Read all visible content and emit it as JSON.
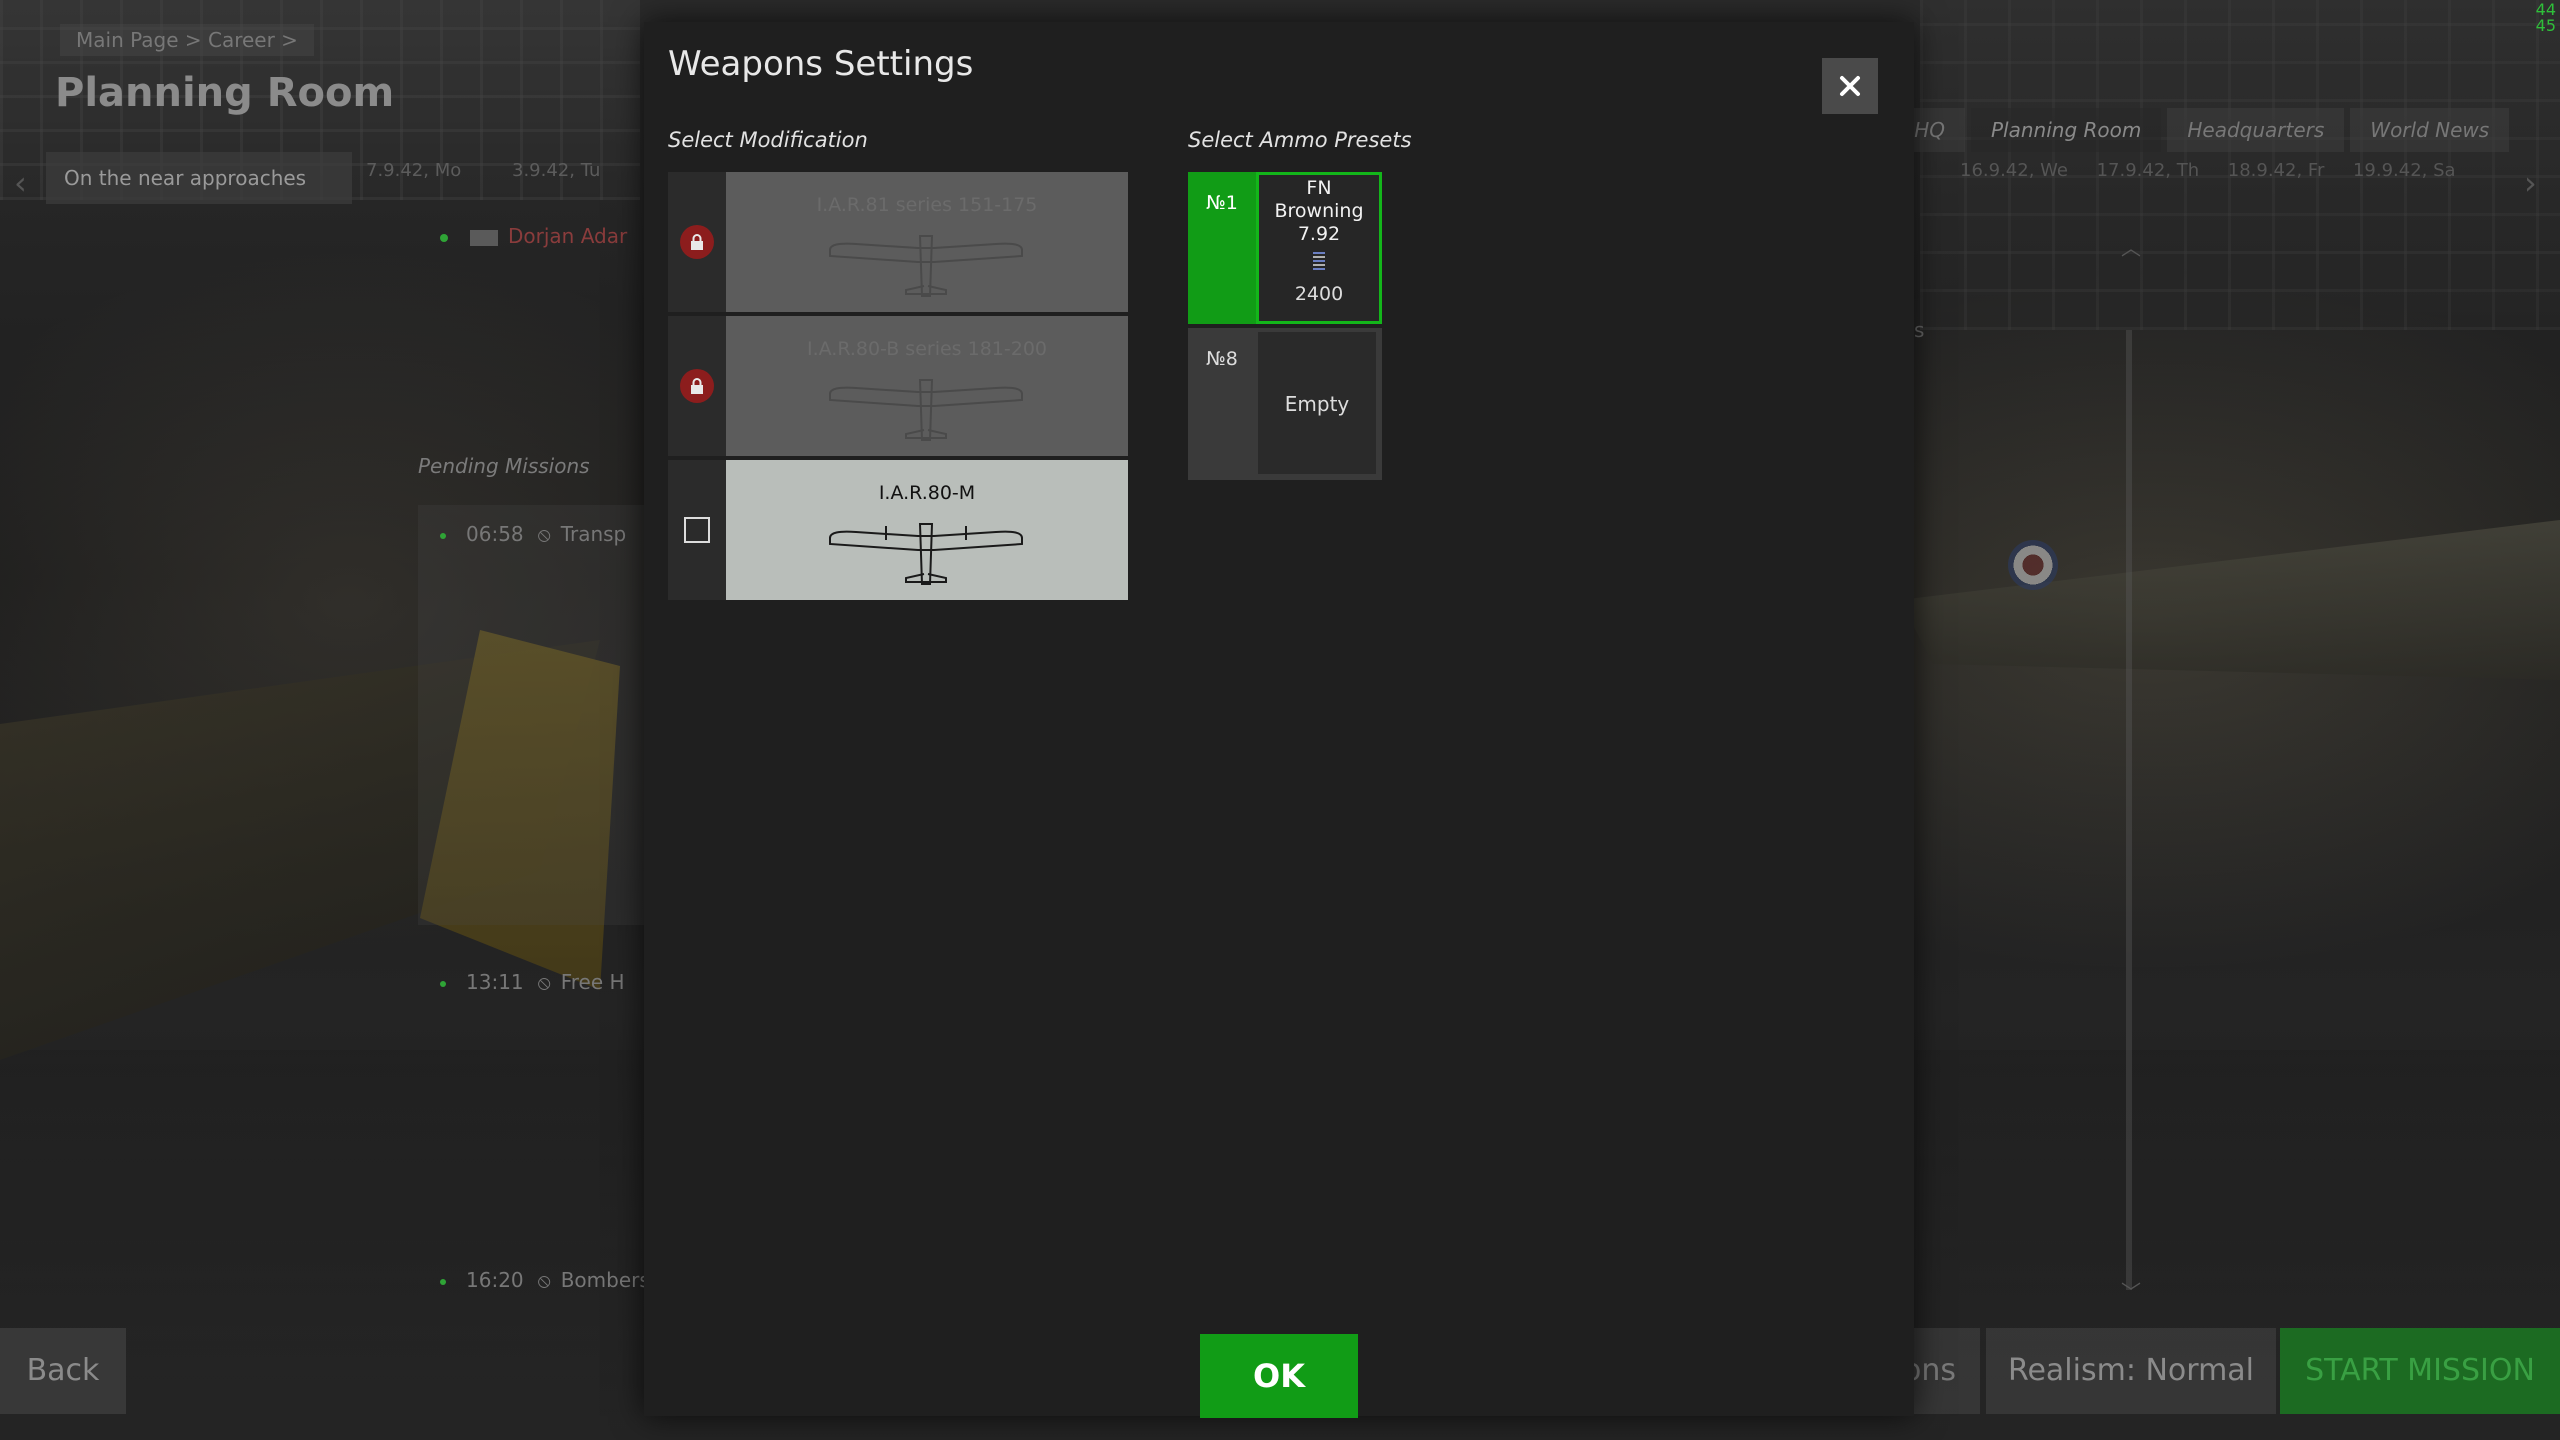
{
  "background": {
    "breadcrumb": "Main Page > Career >",
    "page_title": "Planning Room",
    "mission_name": "On the near approaches",
    "dates": [
      "7.9.42, Mo",
      "3.9.42, Tu"
    ],
    "pilot": "Dorjan Adar",
    "pending_label": "Pending Missions",
    "pending_missions": [
      {
        "time": "06:58",
        "label": "Transp"
      },
      {
        "time": "13:11",
        "label": "Free H"
      },
      {
        "time": "16:20",
        "label": "Bombers"
      }
    ],
    "tabs": [
      {
        "label": "t HQ"
      },
      {
        "label": "Planning Room"
      },
      {
        "label": "Headquarters"
      },
      {
        "label": "World News"
      }
    ],
    "right_dates": [
      "16.9.42, We",
      "17.9.42, Th",
      "18.9.42, Fr",
      "19.9.42, Sa"
    ],
    "partial_text": "s",
    "fps": [
      "44",
      "45"
    ],
    "back_label": "Back",
    "options_label": "ons",
    "realism_label": "Realism: Normal",
    "start_label": "START MISSION"
  },
  "dialog": {
    "title": "Weapons Settings",
    "close_symbol": "✕",
    "modification_label": "Select Modification",
    "ammo_label": "Select Ammo Presets",
    "modifications": [
      {
        "name": "I.A.R.81 series 151-175",
        "state": "locked",
        "icon": "lock-icon"
      },
      {
        "name": "I.A.R.80-B series 181-200",
        "state": "locked",
        "icon": "lock-icon"
      },
      {
        "name": "I.A.R.80-M",
        "state": "available",
        "icon": "checkbox-icon"
      }
    ],
    "ammo_presets": [
      {
        "number": "№1",
        "name": "FN Browning 7.92",
        "count": "2400",
        "selected": true
      },
      {
        "number": "№8",
        "name": "Empty",
        "count": "",
        "selected": false
      }
    ],
    "ok_label": "OK"
  },
  "colors": {
    "accent_green": "#119c16",
    "dialog_bg": "#1f1f1f",
    "lock_red": "#8c1d1d",
    "available_card": "#b9beba"
  }
}
